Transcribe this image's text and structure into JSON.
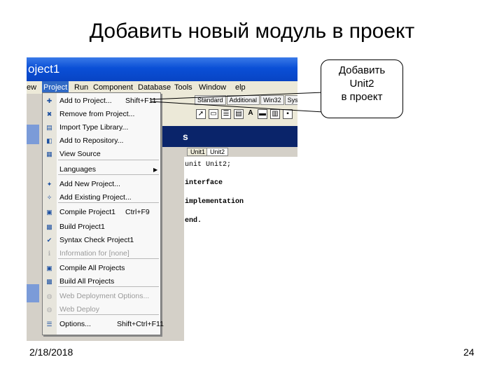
{
  "slide": {
    "title": "Добавить новый модуль в проект",
    "date": "2/18/2018",
    "page_number": "24",
    "callout": {
      "line1": "Добавить",
      "line2": "Unit2",
      "line3": "в проект"
    }
  },
  "ide": {
    "window_title": "oject1",
    "menubar": [
      "ew",
      "Project",
      "Run",
      "Component",
      "Database",
      "Tools",
      "Window",
      "elp"
    ],
    "palette_tabs": [
      "Standard",
      "Additional",
      "Win32",
      "Sys"
    ],
    "editor_header": "s",
    "editor_tabs": [
      "Unit1",
      "Unit2"
    ],
    "code": [
      "unit Unit2;",
      "interface",
      "implementation",
      "end."
    ]
  },
  "project_menu": {
    "items": [
      {
        "label": "Add to Project...",
        "shortcut": "Shift+F11",
        "icon": "add-to-project-icon",
        "glyph": "✚",
        "disabled": false
      },
      {
        "label": "Remove from Project...",
        "shortcut": "",
        "icon": "remove-from-project-icon",
        "glyph": "✖",
        "disabled": false
      },
      {
        "label": "Import Type Library...",
        "shortcut": "",
        "icon": "import-type-library-icon",
        "glyph": "▤",
        "disabled": false
      },
      {
        "label": "Add to Repository...",
        "shortcut": "",
        "icon": "add-to-repository-icon",
        "glyph": "◧",
        "disabled": false
      },
      {
        "label": "View Source",
        "shortcut": "",
        "icon": "view-source-icon",
        "glyph": "▦",
        "disabled": false
      },
      {
        "label": "Languages",
        "shortcut": "",
        "icon": "",
        "glyph": "",
        "disabled": false,
        "submenu": true
      },
      {
        "label": "Add New Project...",
        "shortcut": "",
        "icon": "add-new-project-icon",
        "glyph": "✦",
        "disabled": false
      },
      {
        "label": "Add Existing Project...",
        "shortcut": "",
        "icon": "add-existing-project-icon",
        "glyph": "✧",
        "disabled": false
      },
      {
        "label": "Compile Project1",
        "shortcut": "Ctrl+F9",
        "icon": "compile-icon",
        "glyph": "▣",
        "disabled": false
      },
      {
        "label": "Build Project1",
        "shortcut": "",
        "icon": "build-icon",
        "glyph": "▩",
        "disabled": false
      },
      {
        "label": "Syntax Check Project1",
        "shortcut": "",
        "icon": "syntax-check-icon",
        "glyph": "✔",
        "disabled": false
      },
      {
        "label": "Information for [none]",
        "shortcut": "",
        "icon": "information-icon",
        "glyph": "ℹ",
        "disabled": true
      },
      {
        "label": "Compile All Projects",
        "shortcut": "",
        "icon": "compile-all-icon",
        "glyph": "▣",
        "disabled": false
      },
      {
        "label": "Build All Projects",
        "shortcut": "",
        "icon": "build-all-icon",
        "glyph": "▩",
        "disabled": false
      },
      {
        "label": "Web Deployment Options...",
        "shortcut": "",
        "icon": "web-deployment-icon",
        "glyph": "◍",
        "disabled": true
      },
      {
        "label": "Web Deploy",
        "shortcut": "",
        "icon": "web-deploy-icon",
        "glyph": "◍",
        "disabled": true
      },
      {
        "label": "Options...",
        "shortcut": "Shift+Ctrl+F11",
        "icon": "options-icon",
        "glyph": "☰",
        "disabled": false
      }
    ]
  }
}
